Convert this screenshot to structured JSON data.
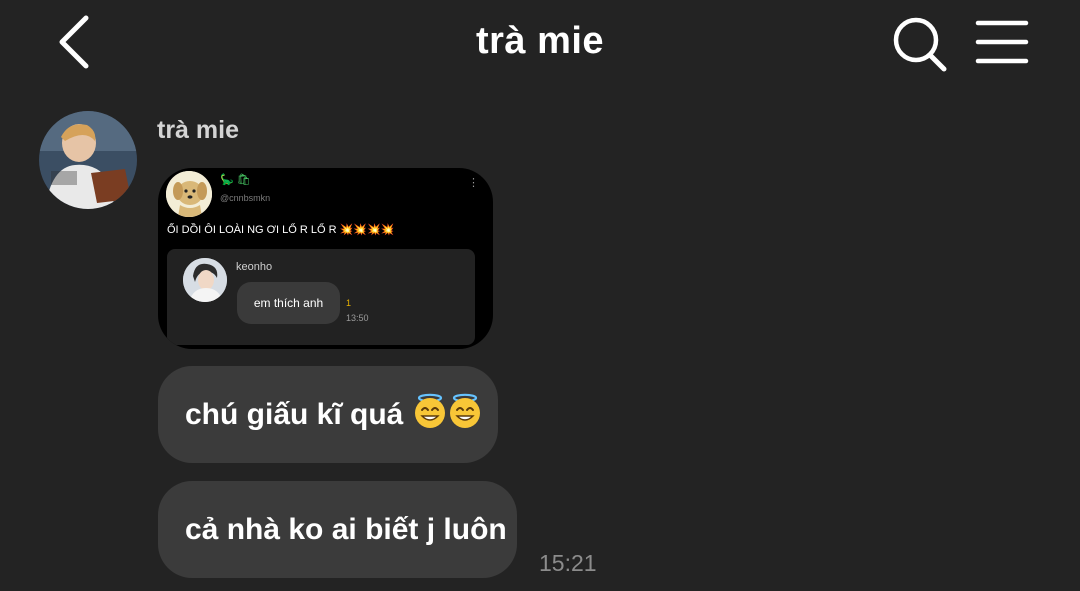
{
  "header": {
    "title": "trà mie",
    "back_icon": "chevron-left-icon",
    "search_icon": "search-icon",
    "menu_icon": "hamburger-menu-icon"
  },
  "message_group": {
    "sender_name": "trà mie",
    "avatar_icon": "avatar",
    "shared_post": {
      "badges": "🦕 🛍",
      "handle": "@cnnbsmkn",
      "more_icon": "more-vertical-icon",
      "text": "ỐI DỒI ÔI LOÀI NG ƠI LỔ R LỔ R",
      "sparks": "💥💥💥💥",
      "inner_chat": {
        "name": "keonho",
        "message": "em thích anh",
        "count": "1",
        "time": "13:50"
      }
    },
    "messages": [
      {
        "text": "chú giấu kĩ quá",
        "emoji": "smiling-face-with-halo x2"
      },
      {
        "text": "cả nhà ko ai biết j luôn"
      }
    ],
    "timestamp": "15:21"
  },
  "colors": {
    "background": "#232323",
    "bubble": "#3b3b3b",
    "text": "#ffffff",
    "secondary_text": "#8c8c8c"
  }
}
